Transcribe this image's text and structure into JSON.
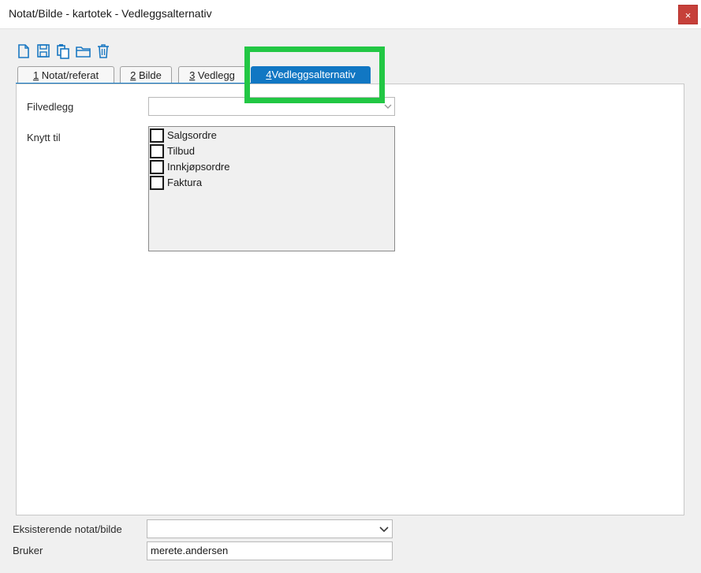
{
  "window": {
    "title": "Notat/Bilde - kartotek - Vedleggsalternativ",
    "close_label": "×"
  },
  "toolbar": [
    {
      "icon": "new-document-icon"
    },
    {
      "icon": "save-icon"
    },
    {
      "icon": "copy-icon"
    },
    {
      "icon": "open-folder-icon"
    },
    {
      "icon": "delete-icon"
    }
  ],
  "tabs": [
    {
      "key": "1",
      "label": "Notat/referat"
    },
    {
      "key": "2",
      "label": "Bilde"
    },
    {
      "key": "3",
      "label": "Vedlegg"
    },
    {
      "key": "4",
      "label": "Vedleggsalternativ",
      "active": true
    }
  ],
  "form": {
    "filvedlegg_label": "Filvedlegg",
    "filvedlegg_value": "",
    "knytt_til_label": "Knytt til",
    "options": [
      {
        "label": "Salgsordre",
        "checked": false
      },
      {
        "label": "Tilbud",
        "checked": false
      },
      {
        "label": "Innkjøpsordre",
        "checked": false
      },
      {
        "label": "Faktura",
        "checked": false
      }
    ]
  },
  "footer": {
    "existing_label": "Eksisterende notat/bilde",
    "existing_value": "",
    "user_label": "Bruker",
    "user_value": "merete.andersen"
  },
  "colors": {
    "accent": "#1177c3",
    "highlight": "#22c744",
    "close": "#c6403a"
  }
}
